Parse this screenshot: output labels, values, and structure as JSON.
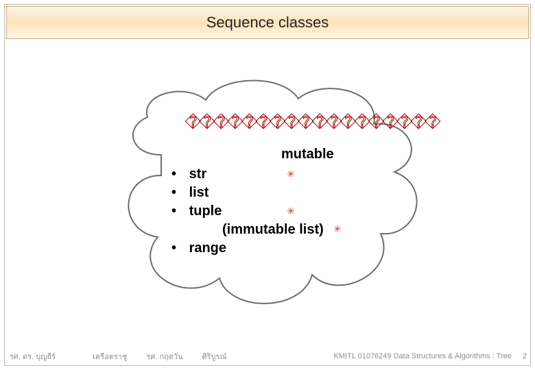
{
  "title": "Sequence classes",
  "cloud": {
    "glitch_line": "������������������",
    "mutable_label": "mutable",
    "items": [
      {
        "bullet": "•",
        "text": "str",
        "mark": "✳"
      },
      {
        "bullet": "•",
        "text": "list",
        "mark": ""
      },
      {
        "bullet": "•",
        "text": "tuple",
        "mark": "✳",
        "sub": "(immutable list)",
        "submark": "✳"
      },
      {
        "bullet": "•",
        "text": "range",
        "mark": ""
      }
    ]
  },
  "footer": {
    "left1": "รศ. ดร. บุญธีร์",
    "left2": "เครือตราชู",
    "left3": "รศ. กฤตวัน",
    "left4": "ศิริบูรณ์",
    "right": "KMITL   01076249 Data Structures & Algorithms : Tree",
    "page": "2"
  },
  "marks": {
    "symbol": "✳"
  }
}
